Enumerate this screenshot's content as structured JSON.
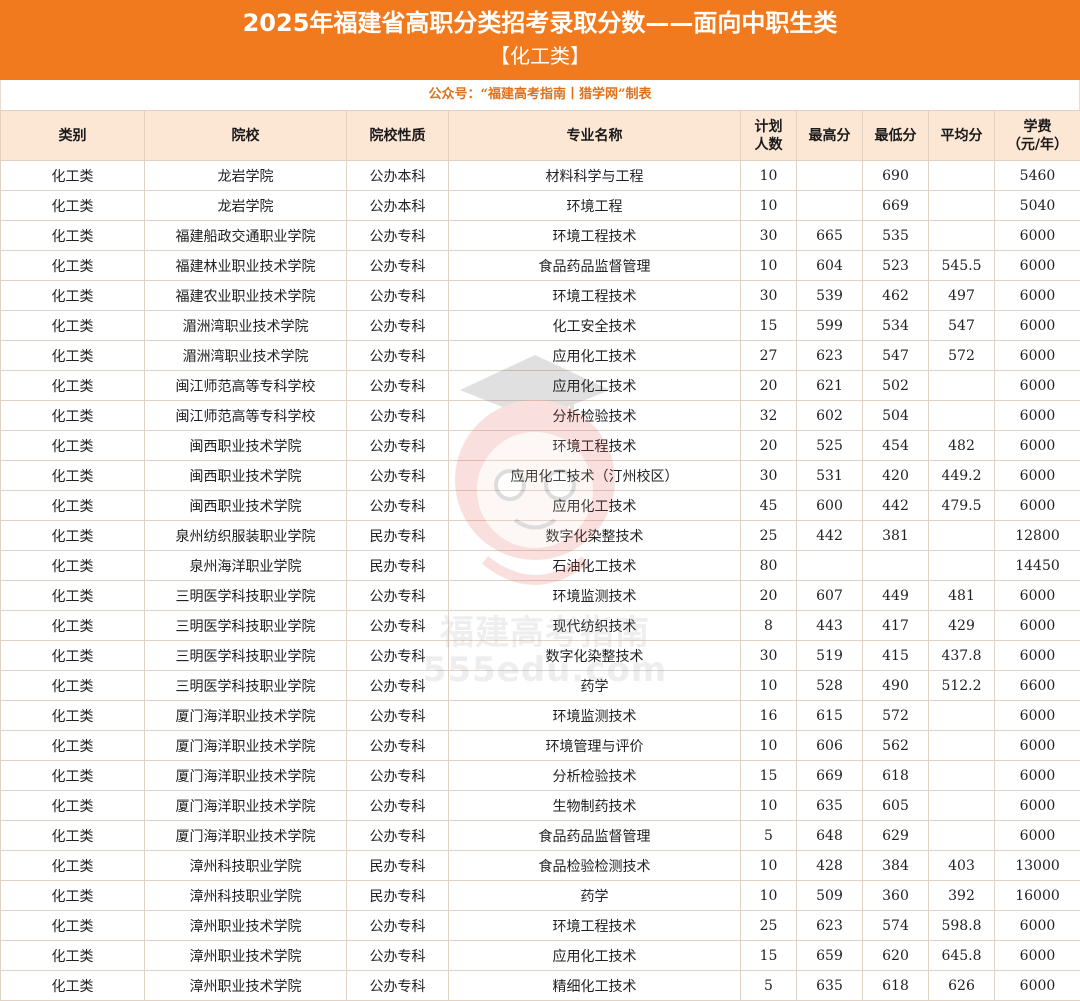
{
  "header": {
    "title": "2025年福建省高职分类招考录取分数——面向中职生类",
    "subtitle": "【化工类】"
  },
  "source_note": "公众号：“福建高考指南丨猎学网”制表",
  "watermark": {
    "line1": "福建高考指南",
    "line2": "555edu.com"
  },
  "table": {
    "columns": [
      "类别",
      "院校",
      "院校性质",
      "专业名称",
      "计划\n人数",
      "最高分",
      "最低分",
      "平均分",
      "学费\n（元/年）"
    ],
    "rows": [
      [
        "化工类",
        "龙岩学院",
        "公办本科",
        "材料科学与工程",
        "10",
        "",
        "690",
        "",
        "5460"
      ],
      [
        "化工类",
        "龙岩学院",
        "公办本科",
        "环境工程",
        "10",
        "",
        "669",
        "",
        "5040"
      ],
      [
        "化工类",
        "福建船政交通职业学院",
        "公办专科",
        "环境工程技术",
        "30",
        "665",
        "535",
        "",
        "6000"
      ],
      [
        "化工类",
        "福建林业职业技术学院",
        "公办专科",
        "食品药品监督管理",
        "10",
        "604",
        "523",
        "545.5",
        "6000"
      ],
      [
        "化工类",
        "福建农业职业技术学院",
        "公办专科",
        "环境工程技术",
        "30",
        "539",
        "462",
        "497",
        "6000"
      ],
      [
        "化工类",
        "湄洲湾职业技术学院",
        "公办专科",
        "化工安全技术",
        "15",
        "599",
        "534",
        "547",
        "6000"
      ],
      [
        "化工类",
        "湄洲湾职业技术学院",
        "公办专科",
        "应用化工技术",
        "27",
        "623",
        "547",
        "572",
        "6000"
      ],
      [
        "化工类",
        "闽江师范高等专科学校",
        "公办专科",
        "应用化工技术",
        "20",
        "621",
        "502",
        "",
        "6000"
      ],
      [
        "化工类",
        "闽江师范高等专科学校",
        "公办专科",
        "分析检验技术",
        "32",
        "602",
        "504",
        "",
        "6000"
      ],
      [
        "化工类",
        "闽西职业技术学院",
        "公办专科",
        "环境工程技术",
        "20",
        "525",
        "454",
        "482",
        "6000"
      ],
      [
        "化工类",
        "闽西职业技术学院",
        "公办专科",
        "应用化工技术（汀州校区）",
        "30",
        "531",
        "420",
        "449.2",
        "6000"
      ],
      [
        "化工类",
        "闽西职业技术学院",
        "公办专科",
        "应用化工技术",
        "45",
        "600",
        "442",
        "479.5",
        "6000"
      ],
      [
        "化工类",
        "泉州纺织服装职业学院",
        "民办专科",
        "数字化染整技术",
        "25",
        "442",
        "381",
        "",
        "12800"
      ],
      [
        "化工类",
        "泉州海洋职业学院",
        "民办专科",
        "石油化工技术",
        "80",
        "",
        "",
        "",
        "14450"
      ],
      [
        "化工类",
        "三明医学科技职业学院",
        "公办专科",
        "环境监测技术",
        "20",
        "607",
        "449",
        "481",
        "6000"
      ],
      [
        "化工类",
        "三明医学科技职业学院",
        "公办专科",
        "现代纺织技术",
        "8",
        "443",
        "417",
        "429",
        "6000"
      ],
      [
        "化工类",
        "三明医学科技职业学院",
        "公办专科",
        "数字化染整技术",
        "30",
        "519",
        "415",
        "437.8",
        "6000"
      ],
      [
        "化工类",
        "三明医学科技职业学院",
        "公办专科",
        "药学",
        "10",
        "528",
        "490",
        "512.2",
        "6600"
      ],
      [
        "化工类",
        "厦门海洋职业技术学院",
        "公办专科",
        "环境监测技术",
        "16",
        "615",
        "572",
        "",
        "6000"
      ],
      [
        "化工类",
        "厦门海洋职业技术学院",
        "公办专科",
        "环境管理与评价",
        "10",
        "606",
        "562",
        "",
        "6000"
      ],
      [
        "化工类",
        "厦门海洋职业技术学院",
        "公办专科",
        "分析检验技术",
        "15",
        "669",
        "618",
        "",
        "6000"
      ],
      [
        "化工类",
        "厦门海洋职业技术学院",
        "公办专科",
        "生物制药技术",
        "10",
        "635",
        "605",
        "",
        "6000"
      ],
      [
        "化工类",
        "厦门海洋职业技术学院",
        "公办专科",
        "食品药品监督管理",
        "5",
        "648",
        "629",
        "",
        "6000"
      ],
      [
        "化工类",
        "漳州科技职业学院",
        "民办专科",
        "食品检验检测技术",
        "10",
        "428",
        "384",
        "403",
        "13000"
      ],
      [
        "化工类",
        "漳州科技职业学院",
        "民办专科",
        "药学",
        "10",
        "509",
        "360",
        "392",
        "16000"
      ],
      [
        "化工类",
        "漳州职业技术学院",
        "公办专科",
        "环境工程技术",
        "25",
        "623",
        "574",
        "598.8",
        "6000"
      ],
      [
        "化工类",
        "漳州职业技术学院",
        "公办专科",
        "应用化工技术",
        "15",
        "659",
        "620",
        "645.8",
        "6000"
      ],
      [
        "化工类",
        "漳州职业技术学院",
        "公办专科",
        "精细化工技术",
        "5",
        "635",
        "618",
        "626",
        "6000"
      ]
    ]
  }
}
